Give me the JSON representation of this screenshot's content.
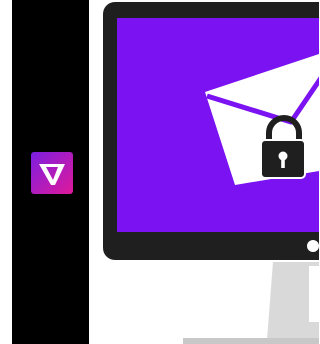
{
  "brand": {
    "logo_icon": "brand-v-logo-icon",
    "gradient_start": "#7b1fe0",
    "gradient_end": "#e0199b",
    "mark_color": "#ffffff"
  },
  "illustration": {
    "subject": "monitor-with-locked-envelope",
    "screen_color": "#7b12f2",
    "frame_color": "#1f1f1f",
    "envelope_color": "#ffffff",
    "lock_color": "#1f1f1f",
    "stand_color": "#d9d9d9",
    "icons": [
      "envelope-icon",
      "padlock-icon",
      "power-led-icon"
    ]
  },
  "layout_colors": {
    "sidebar_bg": "#000000",
    "page_bg": "#ffffff"
  }
}
